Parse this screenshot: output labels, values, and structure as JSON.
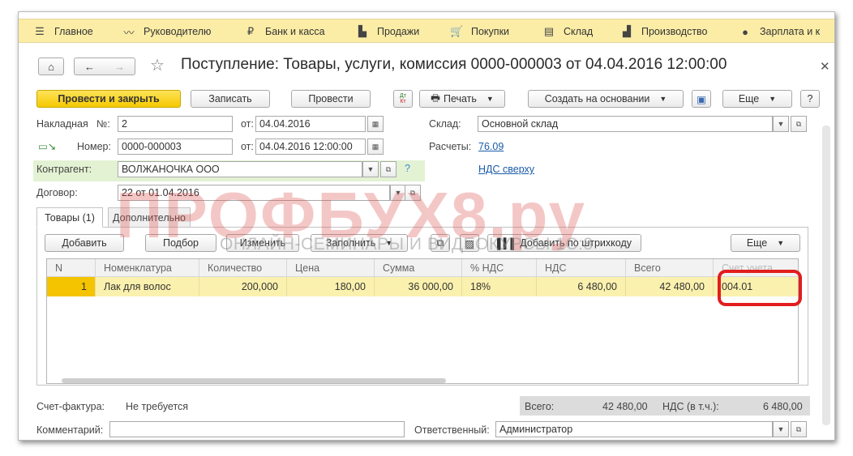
{
  "menu": [
    {
      "icon": "hamburger-icon",
      "label": "Главное"
    },
    {
      "icon": "trend-icon",
      "label": "Руководителю"
    },
    {
      "icon": "ruble-icon",
      "label": "Банк и касса"
    },
    {
      "icon": "bag-icon",
      "label": "Продажи"
    },
    {
      "icon": "cart-icon",
      "label": "Покупки"
    },
    {
      "icon": "warehouse-icon",
      "label": "Склад"
    },
    {
      "icon": "factory-icon",
      "label": "Производство"
    },
    {
      "icon": "person-icon",
      "label": "Зарплата и к"
    }
  ],
  "header": {
    "title": "Поступление: Товары, услуги, комиссия 0000-000003 от 04.04.2016 12:00:00"
  },
  "toolbar": {
    "post_close": "Провести и закрыть",
    "save": "Записать",
    "post": "Провести",
    "dtkt_top": "Дт",
    "dtkt_bottom": "Кт",
    "print": "Печать",
    "create_based": "Создать на основании",
    "more": "Еще",
    "help": "?"
  },
  "form": {
    "invoice_label": "Накладная",
    "no_label": "№:",
    "invoice_no": "2",
    "from_label": "от:",
    "invoice_date": "04.04.2016",
    "number_label": "Номер:",
    "number": "0000-000003",
    "from_label2": "от:",
    "datetime": "04.04.2016 12:00:00",
    "warehouse_label": "Склад:",
    "warehouse": "Основной склад",
    "settlements_label": "Расчеты:",
    "settlements": "76.09",
    "counterparty_label": "Контрагент:",
    "counterparty": "ВОЛЖАНОЧКА ООО",
    "vat_link": "НДС сверху",
    "contract_label": "Договор:",
    "contract": "22 от 01.04.2016"
  },
  "tabs": [
    {
      "label": "Товары (1)"
    },
    {
      "label": "Дополнительно"
    }
  ],
  "table_toolbar": {
    "add": "Добавить",
    "pick": "Подбор",
    "change": "Изменить",
    "fill": "Заполнить",
    "barcode": "Добавить по штрихкоду",
    "more": "Еще"
  },
  "table": {
    "columns": [
      "N",
      "Номенклатура",
      "Количество",
      "Цена",
      "Сумма",
      "% НДС",
      "НДС",
      "Всего",
      "Счет учета"
    ],
    "rows": [
      [
        "1",
        "Лак для волос",
        "200,000",
        "180,00",
        "36 000,00",
        "18%",
        "6 480,00",
        "42 480,00",
        "004.01"
      ]
    ]
  },
  "footer": {
    "invoice_label": "Счет-фактура:",
    "invoice_value": "Не требуется",
    "total_label": "Всего:",
    "total": "42 480,00",
    "vat_label": "НДС (в т.ч.):",
    "vat": "6 480,00",
    "comment_label": "Комментарий:",
    "comment": "",
    "responsible_label": "Ответственный:",
    "responsible": "Администратор"
  },
  "watermark": {
    "main": "ПРОФБУХ8.ру",
    "sub": "ОНЛАЙН-СЕМИНАРЫ И ВИДЕОКУРСЫ 1С:8"
  },
  "colors": {
    "menu_bg": "#fbeda6",
    "primary": "#f5c900",
    "selected_row": "#fbf1ae",
    "highlight": "#e21d1d",
    "link": "#1a5aa8"
  }
}
